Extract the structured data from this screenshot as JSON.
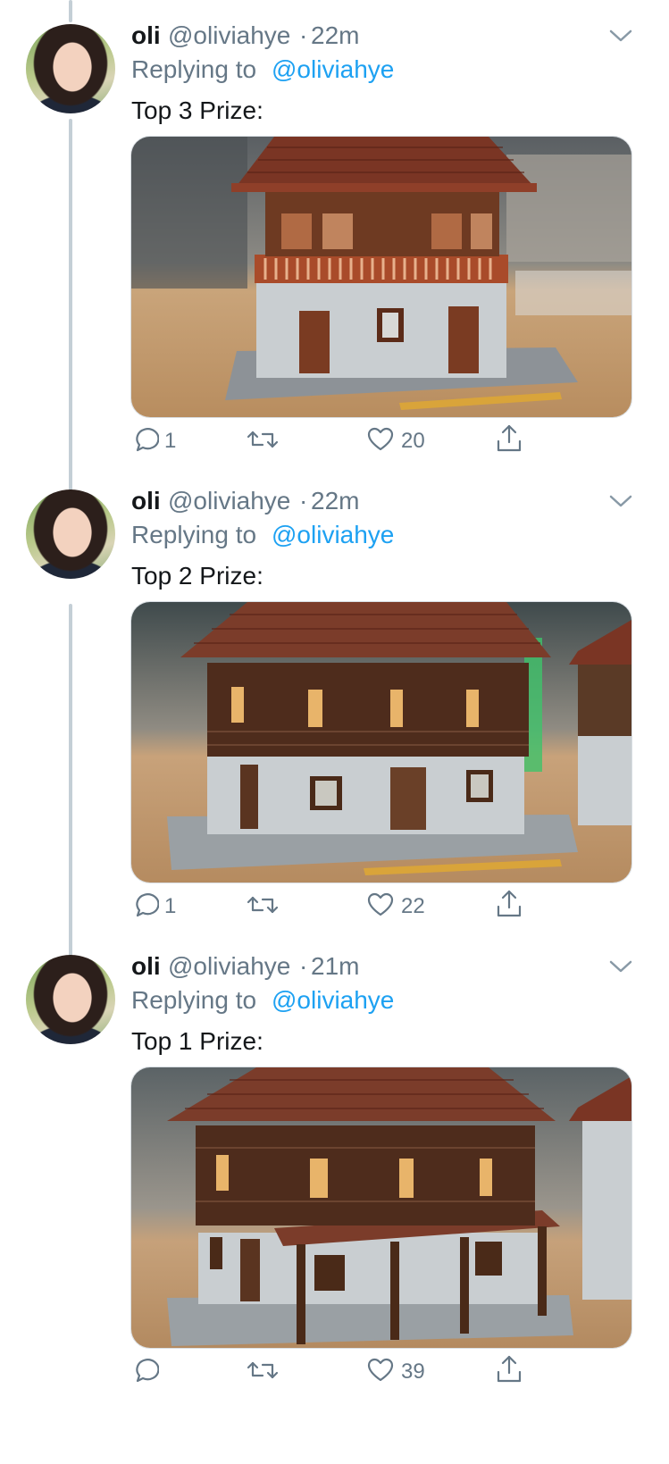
{
  "tweets": [
    {
      "display_name": "oli",
      "handle": "@oliviahye",
      "dot": "·",
      "time": "22m",
      "replying_prefix": "Replying to",
      "replying_handle": "@oliviahye",
      "text": "Top 3 Prize:",
      "media_icon": "house-model-photo",
      "reply_count": "1",
      "retweet_count": "",
      "like_count": "20"
    },
    {
      "display_name": "oli",
      "handle": "@oliviahye",
      "dot": "·",
      "time": "22m",
      "replying_prefix": "Replying to",
      "replying_handle": "@oliviahye",
      "text": "Top 2 Prize:",
      "media_icon": "house-model-photo",
      "reply_count": "1",
      "retweet_count": "",
      "like_count": "22"
    },
    {
      "display_name": "oli",
      "handle": "@oliviahye",
      "dot": "·",
      "time": "21m",
      "replying_prefix": "Replying to",
      "replying_handle": "@oliviahye",
      "text": "Top 1 Prize:",
      "media_icon": "house-model-photo",
      "reply_count": "",
      "retweet_count": "",
      "like_count": "39"
    }
  ],
  "colors": {
    "link": "#1da1f2",
    "secondary_text": "#657786",
    "primary_text": "#14171a",
    "thread_line": "#c4cfd6"
  }
}
